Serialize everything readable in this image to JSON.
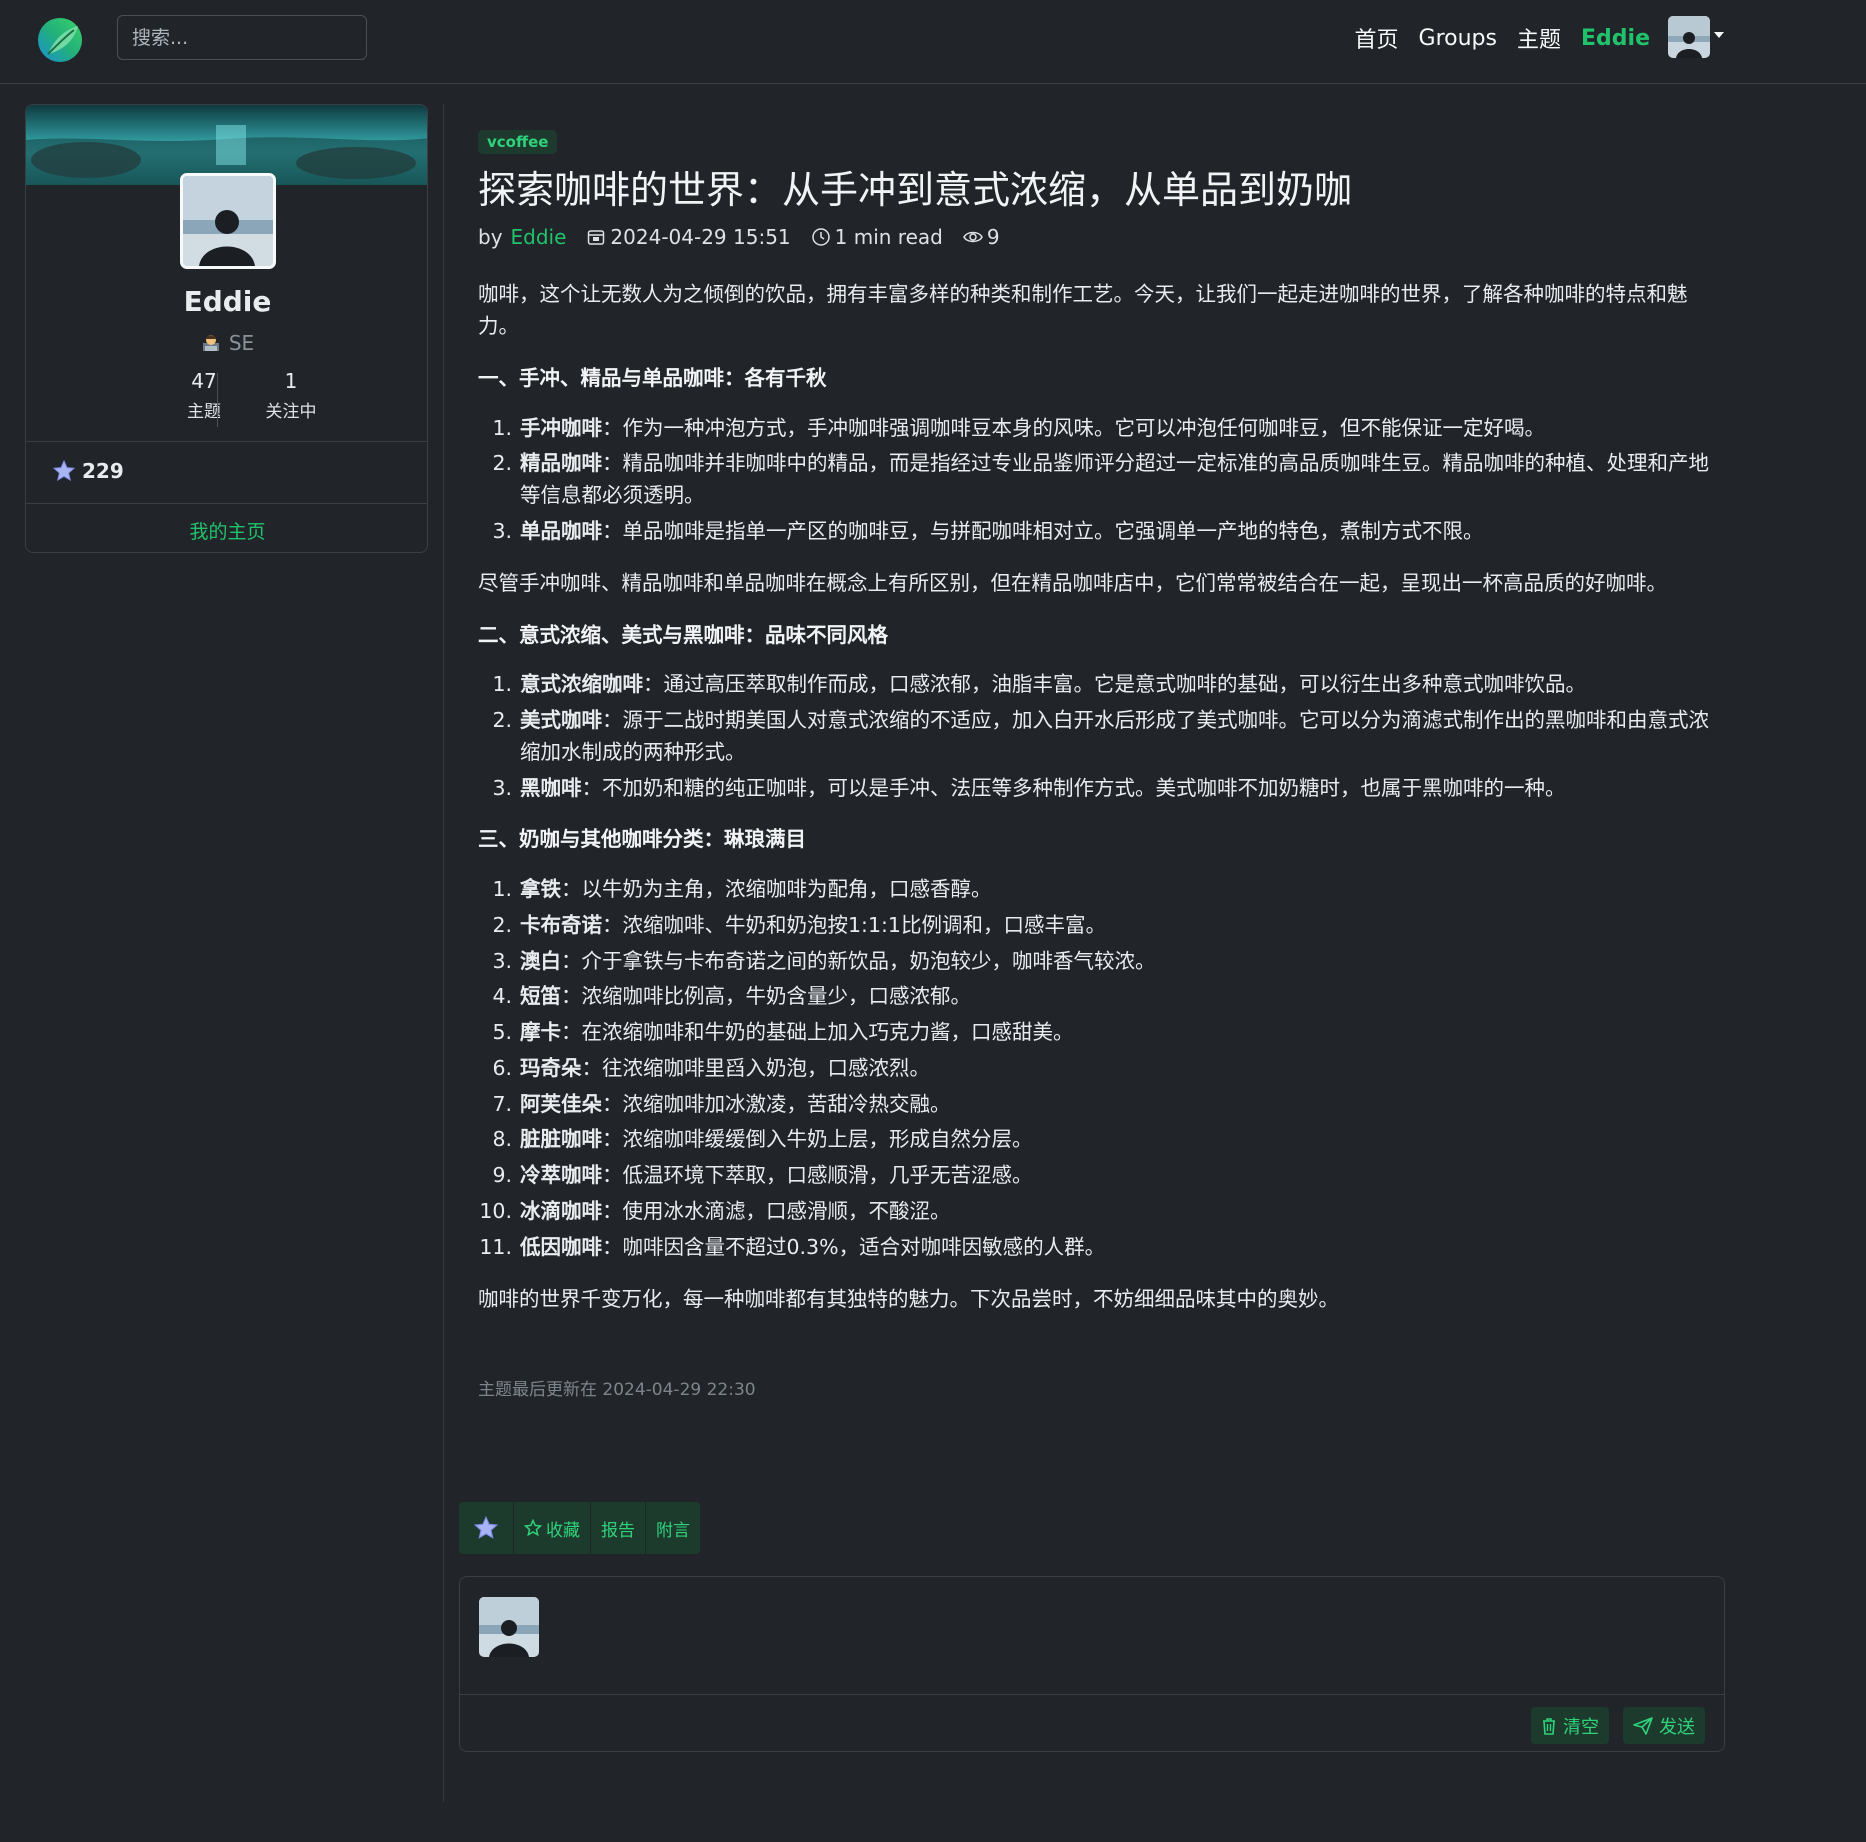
{
  "nav": {
    "search_placeholder": "搜索...",
    "links": [
      "首页",
      "Groups",
      "主题"
    ],
    "user": "Eddie"
  },
  "profile": {
    "name": "Eddie",
    "role": "SE",
    "stats": [
      {
        "num": "47",
        "label": "主题"
      },
      {
        "num": "1",
        "label": "关注中"
      }
    ],
    "points": "229",
    "home_link": "我的主页"
  },
  "article": {
    "tag": "vcoffee",
    "title": "探索咖啡的世界：从手冲到意式浓缩，从单品到奶咖",
    "by": "by",
    "author": "Eddie",
    "date": "2024-04-29 15:51",
    "read_time": "1 min read",
    "views": "9",
    "intro": "咖啡，这个让无数人为之倾倒的饮品，拥有丰富多样的种类和制作工艺。今天，让我们一起走进咖啡的世界，了解各种咖啡的特点和魅力。",
    "sections": [
      {
        "heading": "一、手冲、精品与单品咖啡：各有千秋",
        "items": [
          {
            "n": "1.",
            "term": "手冲咖啡",
            "desc": "：作为一种冲泡方式，手冲咖啡强调咖啡豆本身的风味。它可以冲泡任何咖啡豆，但不能保证一定好喝。"
          },
          {
            "n": "2.",
            "term": "精品咖啡",
            "desc": "：精品咖啡并非咖啡中的精品，而是指经过专业品鉴师评分超过一定标准的高品质咖啡生豆。精品咖啡的种植、处理和产地等信息都必须透明。"
          },
          {
            "n": "3.",
            "term": "单品咖啡",
            "desc": "：单品咖啡是指单一产区的咖啡豆，与拼配咖啡相对立。它强调单一产地的特色，煮制方式不限。"
          }
        ],
        "after": "尽管手冲咖啡、精品咖啡和单品咖啡在概念上有所区别，但在精品咖啡店中，它们常常被结合在一起，呈现出一杯高品质的好咖啡。"
      },
      {
        "heading": "二、意式浓缩、美式与黑咖啡：品味不同风格",
        "items": [
          {
            "n": "1.",
            "term": "意式浓缩咖啡",
            "desc": "：通过高压萃取制作而成，口感浓郁，油脂丰富。它是意式咖啡的基础，可以衍生出多种意式咖啡饮品。"
          },
          {
            "n": "2.",
            "term": "美式咖啡",
            "desc": "：源于二战时期美国人对意式浓缩的不适应，加入白开水后形成了美式咖啡。它可以分为滴滤式制作出的黑咖啡和由意式浓缩加水制成的两种形式。"
          },
          {
            "n": "3.",
            "term": "黑咖啡",
            "desc": "：不加奶和糖的纯正咖啡，可以是手冲、法压等多种制作方式。美式咖啡不加奶糖时，也属于黑咖啡的一种。"
          }
        ],
        "after": ""
      },
      {
        "heading": "三、奶咖与其他咖啡分类：琳琅满目",
        "items": [
          {
            "n": "1.",
            "term": "拿铁",
            "desc": "：以牛奶为主角，浓缩咖啡为配角，口感香醇。"
          },
          {
            "n": "2.",
            "term": "卡布奇诺",
            "desc": "：浓缩咖啡、牛奶和奶泡按1:1:1比例调和，口感丰富。"
          },
          {
            "n": "3.",
            "term": "澳白",
            "desc": "：介于拿铁与卡布奇诺之间的新饮品，奶泡较少，咖啡香气较浓。"
          },
          {
            "n": "4.",
            "term": "短笛",
            "desc": "：浓缩咖啡比例高，牛奶含量少，口感浓郁。"
          },
          {
            "n": "5.",
            "term": "摩卡",
            "desc": "：在浓缩咖啡和牛奶的基础上加入巧克力酱，口感甜美。"
          },
          {
            "n": "6.",
            "term": "玛奇朵",
            "desc": "：往浓缩咖啡里舀入奶泡，口感浓烈。"
          },
          {
            "n": "7.",
            "term": "阿芙佳朵",
            "desc": "：浓缩咖啡加冰激凌，苦甜冷热交融。"
          },
          {
            "n": "8.",
            "term": "脏脏咖啡",
            "desc": "：浓缩咖啡缓缓倒入牛奶上层，形成自然分层。"
          },
          {
            "n": "9.",
            "term": "冷萃咖啡",
            "desc": "：低温环境下萃取，口感顺滑，几乎无苦涩感。"
          },
          {
            "n": "10.",
            "term": "冰滴咖啡",
            "desc": "：使用冰水滴滤，口感滑顺，不酸涩。"
          },
          {
            "n": "11.",
            "term": "低因咖啡",
            "desc": "：咖啡因含量不超过0.3%，适合对咖啡因敏感的人群。"
          }
        ],
        "after": "咖啡的世界千变万化，每一种咖啡都有其独特的魅力。下次品尝时，不妨细细品味其中的奥妙。"
      }
    ],
    "updated": "主题最后更新在 2024-04-29 22:30"
  },
  "actions": {
    "favorite": "收藏",
    "report": "报告",
    "append": "附言"
  },
  "comment": {
    "clear": "清空",
    "send": "发送"
  },
  "colors": {
    "accent": "#20c36b",
    "background": "#212529"
  }
}
